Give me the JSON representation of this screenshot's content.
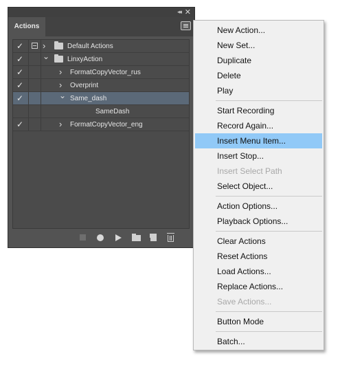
{
  "panel": {
    "tab_label": "Actions",
    "collapse_glyph": "◂◂",
    "close_glyph": "✕",
    "check_glyph": "✓",
    "rows": [
      {
        "label": "Default Actions",
        "level": 0,
        "expanded": false,
        "checked": true,
        "dialog_toggle": true,
        "type": "set"
      },
      {
        "label": "LinxyAction",
        "level": 0,
        "expanded": true,
        "checked": true,
        "dialog_toggle": false,
        "type": "set"
      },
      {
        "label": "FormatCopyVector_rus",
        "level": 1,
        "expanded": false,
        "checked": true,
        "dialog_toggle": false,
        "type": "action"
      },
      {
        "label": "Overprint",
        "level": 1,
        "expanded": false,
        "checked": true,
        "dialog_toggle": false,
        "type": "action"
      },
      {
        "label": "Same_dash",
        "level": 1,
        "expanded": true,
        "checked": true,
        "dialog_toggle": false,
        "type": "action",
        "selected": true
      },
      {
        "label": "SameDash",
        "level": 2,
        "expanded": false,
        "checked": false,
        "dialog_toggle": false,
        "type": "step"
      },
      {
        "label": "FormatCopyVector_eng",
        "level": 1,
        "expanded": false,
        "checked": true,
        "dialog_toggle": false,
        "type": "action"
      }
    ],
    "bottom_icons": [
      "stop-icon",
      "record-icon",
      "play-icon",
      "new-set-icon",
      "new-action-icon",
      "trash-icon"
    ]
  },
  "menu": {
    "groups": [
      [
        {
          "label": "New Action...",
          "enabled": true
        },
        {
          "label": "New Set...",
          "enabled": true
        },
        {
          "label": "Duplicate",
          "enabled": true
        },
        {
          "label": "Delete",
          "enabled": true
        },
        {
          "label": "Play",
          "enabled": true
        }
      ],
      [
        {
          "label": "Start Recording",
          "enabled": true
        },
        {
          "label": "Record Again...",
          "enabled": true
        },
        {
          "label": "Insert Menu Item...",
          "enabled": true,
          "highlighted": true
        },
        {
          "label": "Insert Stop...",
          "enabled": true
        },
        {
          "label": "Insert Select Path",
          "enabled": false
        },
        {
          "label": "Select Object...",
          "enabled": true
        }
      ],
      [
        {
          "label": "Action Options...",
          "enabled": true
        },
        {
          "label": "Playback Options...",
          "enabled": true
        }
      ],
      [
        {
          "label": "Clear Actions",
          "enabled": true
        },
        {
          "label": "Reset Actions",
          "enabled": true
        },
        {
          "label": "Load Actions...",
          "enabled": true
        },
        {
          "label": "Replace Actions...",
          "enabled": true
        },
        {
          "label": "Save Actions...",
          "enabled": false
        }
      ],
      [
        {
          "label": "Button Mode",
          "enabled": true
        }
      ],
      [
        {
          "label": "Batch...",
          "enabled": true
        }
      ]
    ]
  },
  "colors": {
    "panel_bg": "#535353",
    "selected_row": "#5b6978",
    "menu_bg": "#f0f0f0",
    "menu_highlight": "#91c9f7",
    "disabled_text": "#a8a8a8"
  }
}
